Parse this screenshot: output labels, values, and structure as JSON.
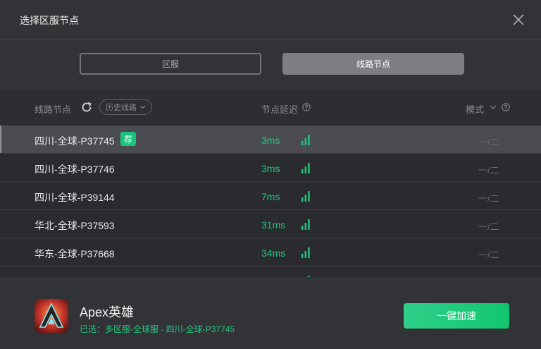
{
  "header": {
    "title": "选择区服节点"
  },
  "tabs": [
    {
      "label": "区服",
      "active": false
    },
    {
      "label": "线路节点",
      "active": true
    }
  ],
  "table": {
    "col_node": "线路节点",
    "history_label": "历史线路",
    "col_latency": "节点延迟",
    "col_mode": "模式",
    "badge": "荐",
    "rows": [
      {
        "name": "四川-全球-P37745",
        "latency": "3ms",
        "mode": "一/二",
        "recommended": true,
        "selected": true
      },
      {
        "name": "四川-全球-P37746",
        "latency": "3ms",
        "mode": "一/二",
        "recommended": false,
        "selected": false
      },
      {
        "name": "四川-全球-P39144",
        "latency": "7ms",
        "mode": "一/二",
        "recommended": false,
        "selected": false
      },
      {
        "name": "华北-全球-P37593",
        "latency": "31ms",
        "mode": "一/二",
        "recommended": false,
        "selected": false
      },
      {
        "name": "华东-全球-P37668",
        "latency": "34ms",
        "mode": "一/二",
        "recommended": false,
        "selected": false
      }
    ]
  },
  "footer": {
    "app_name": "Apex英雄",
    "selected_text": "已选：多区服-全球服 - 四川-全球-P37745",
    "accelerate_label": "一键加速"
  },
  "colors": {
    "accent": "#22c77d",
    "background": "#323337",
    "table_bg": "#2a2b2f",
    "selected_row": "#4b4c51"
  }
}
